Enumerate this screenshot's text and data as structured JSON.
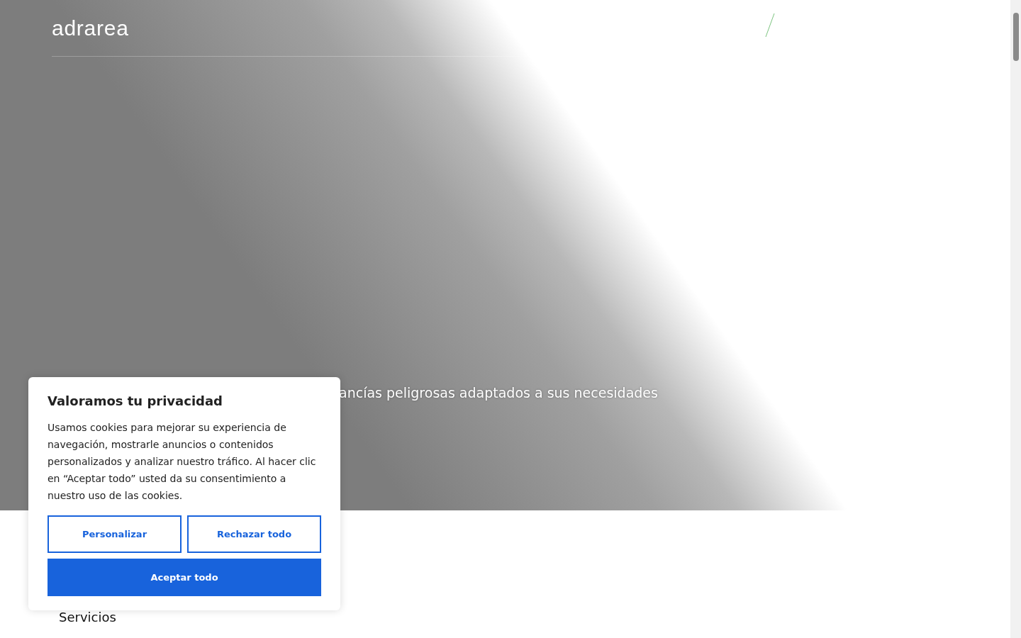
{
  "header": {
    "logo": "adrarea"
  },
  "hero": {
    "tagline": "ancías peligrosas adaptados a sus necesidades"
  },
  "section": {
    "title": "Servicios"
  },
  "cookie_banner": {
    "title": "Valoramos tu privacidad",
    "text": "Usamos cookies para mejorar su experiencia de navegación, mostrarle anuncios o contenidos personalizados y analizar nuestro tráfico. Al hacer clic en “Aceptar todo” usted da su consentimiento a nuestro uso de las cookies.",
    "buttons": [
      {
        "label": "Personalizar",
        "kind": "outline"
      },
      {
        "label": "Rechazar todo",
        "kind": "outline"
      },
      {
        "label": "Aceptar todo",
        "kind": "primary"
      }
    ]
  }
}
